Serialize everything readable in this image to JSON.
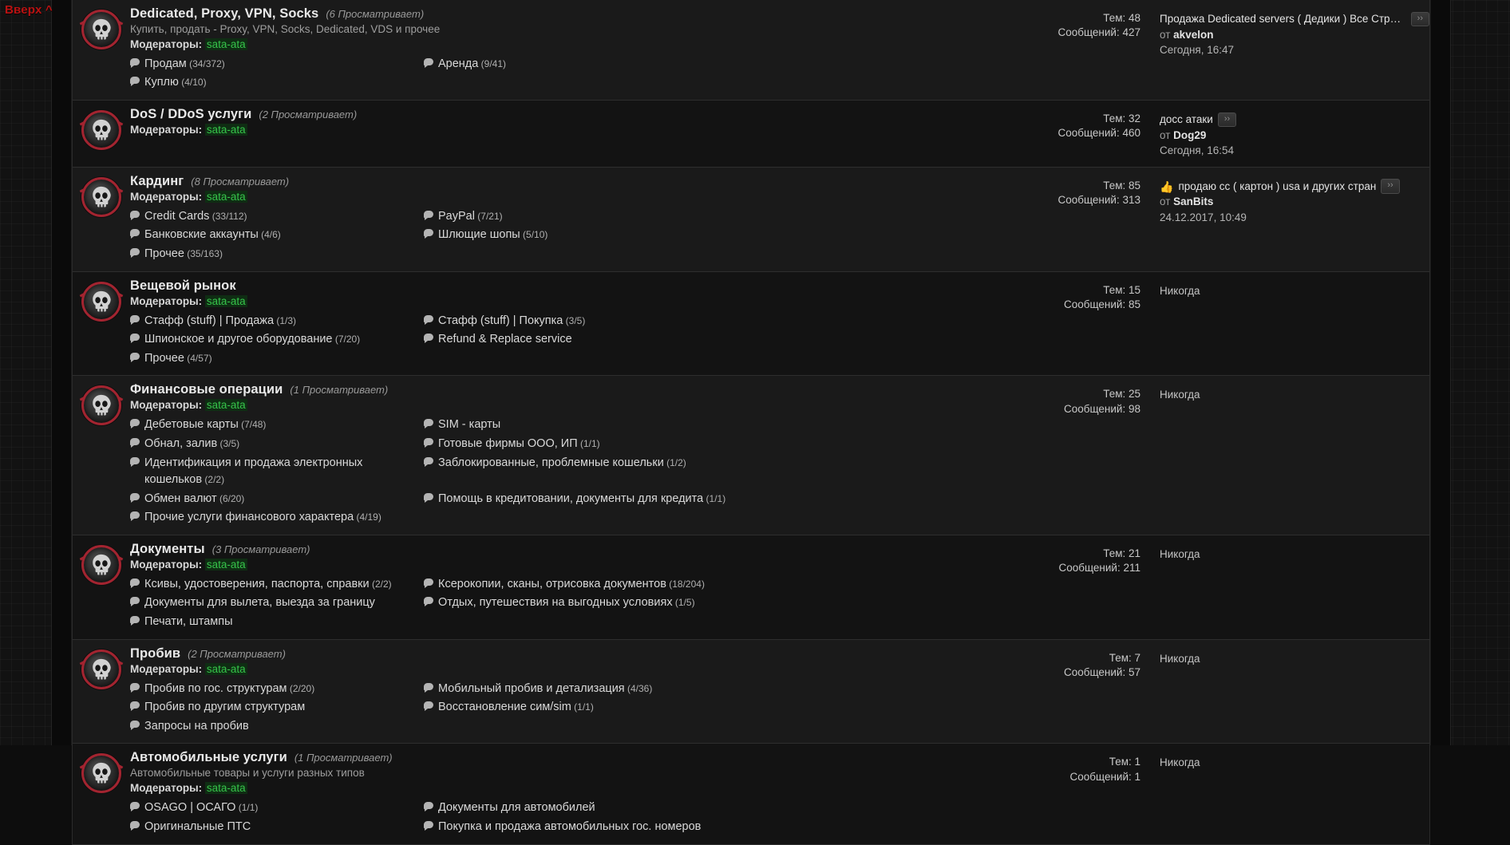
{
  "scroll_top_label": "Вверх ^",
  "labels": {
    "moderators": "Модераторы:",
    "threads_prefix": "Тем:",
    "messages_prefix": "Сообщений:",
    "by_prefix": "от",
    "never": "Никогда",
    "jump_to_last": "››"
  },
  "colors": {
    "accent_red": "#a32430",
    "moderator_green": "#36c44a",
    "scroll_top_red": "#b91212",
    "row_bg": "#1a1a1a",
    "row_bg_alt": "#131313"
  },
  "nodes": [
    {
      "title": "Dedicated, Proxy, VPN, Socks",
      "viewers": "(6 Просматривает)",
      "description": "Купить, продать - Proxy, VPN, Socks, Dedicated, VDS и прочее",
      "moderator": "sata-ata",
      "subforums": [
        {
          "label": "Продам",
          "count": "(34/372)"
        },
        {
          "label": "Аренда",
          "count": "(9/41)"
        },
        {
          "label": "Куплю",
          "count": "(4/10)"
        },
        {
          "label": "",
          "count": ""
        }
      ],
      "threads": "48",
      "messages": "427",
      "last_post": {
        "title": "Продажа Dedicated servers ( Дедики ) Все Страны...",
        "author": "akvelon",
        "date": "Сегодня, 16:47",
        "has_jump": true,
        "emoji": ""
      }
    },
    {
      "title": "DoS / DDoS услуги",
      "viewers": "(2 Просматривает)",
      "description": "",
      "moderator": "sata-ata",
      "subforums": [],
      "threads": "32",
      "messages": "460",
      "last_post": {
        "title": "досс атаки",
        "author": "Dog29",
        "date": "Сегодня, 16:54",
        "has_jump": true,
        "emoji": ""
      }
    },
    {
      "title": "Кардинг",
      "viewers": "(8 Просматривает)",
      "description": "",
      "moderator": "sata-ata",
      "subforums": [
        {
          "label": "Credit Cards",
          "count": "(33/112)"
        },
        {
          "label": "PayPal",
          "count": "(7/21)"
        },
        {
          "label": "Банковские аккаунты",
          "count": "(4/6)"
        },
        {
          "label": "Шлющие шопы",
          "count": "(5/10)"
        },
        {
          "label": "Прочее",
          "count": "(35/163)"
        },
        {
          "label": "",
          "count": ""
        }
      ],
      "threads": "85",
      "messages": "313",
      "last_post": {
        "title": "продаю cc ( картон ) usa и других стран",
        "author": "SanBits",
        "date": "24.12.2017, 10:49",
        "has_jump": true,
        "emoji": "👍"
      }
    },
    {
      "title": "Вещевой рынок",
      "viewers": "",
      "description": "",
      "moderator": "sata-ata",
      "subforums": [
        {
          "label": "Стафф (stuff) | Продажа",
          "count": "(1/3)"
        },
        {
          "label": "Стафф (stuff) | Покупка",
          "count": "(3/5)"
        },
        {
          "label": "Шпионское и другое оборудование",
          "count": "(7/20)"
        },
        {
          "label": "Refund & Replace service",
          "count": ""
        },
        {
          "label": "Прочее",
          "count": "(4/57)"
        },
        {
          "label": "",
          "count": ""
        }
      ],
      "threads": "15",
      "messages": "85",
      "last_post": {
        "title": "",
        "author": "",
        "date": "",
        "has_jump": false,
        "emoji": "",
        "never": true
      }
    },
    {
      "title": "Финансовые операции",
      "viewers": "(1 Просматривает)",
      "description": "",
      "moderator": "sata-ata",
      "subforums": [
        {
          "label": "Дебетовые карты",
          "count": "(7/48)"
        },
        {
          "label": "SIM - карты",
          "count": ""
        },
        {
          "label": "Обнал, залив",
          "count": "(3/5)"
        },
        {
          "label": "Готовые фирмы ООО, ИП",
          "count": "(1/1)"
        },
        {
          "label": "Идентификация и продажа электронных кошельков",
          "count": "(2/2)"
        },
        {
          "label": "Заблокированные, проблемные кошельки",
          "count": "(1/2)"
        },
        {
          "label": "Обмен валют",
          "count": "(6/20)"
        },
        {
          "label": "Помощь в кредитовании, документы для кредита",
          "count": "(1/1)"
        },
        {
          "label": "Прочие услуги финансового характера",
          "count": "(4/19)"
        },
        {
          "label": "",
          "count": ""
        }
      ],
      "threads": "25",
      "messages": "98",
      "last_post": {
        "title": "",
        "author": "",
        "date": "",
        "has_jump": false,
        "emoji": "",
        "never": true
      }
    },
    {
      "title": "Документы",
      "viewers": "(3 Просматривает)",
      "description": "",
      "moderator": "sata-ata",
      "subforums": [
        {
          "label": "Ксивы, удостоверения, паспорта, справки",
          "count": "(2/2)"
        },
        {
          "label": "Ксерокопии, сканы, отрисовка документов",
          "count": "(18/204)"
        },
        {
          "label": "Документы для вылета, выезда за границу",
          "count": ""
        },
        {
          "label": "Отдых, путешествия на выгодных условиях",
          "count": "(1/5)"
        },
        {
          "label": "Печати, штампы",
          "count": ""
        },
        {
          "label": "",
          "count": ""
        }
      ],
      "threads": "21",
      "messages": "211",
      "last_post": {
        "title": "",
        "author": "",
        "date": "",
        "has_jump": false,
        "emoji": "",
        "never": true
      }
    },
    {
      "title": "Пробив",
      "viewers": "(2 Просматривает)",
      "description": "",
      "moderator": "sata-ata",
      "subforums": [
        {
          "label": "Пробив по гос. структурам",
          "count": "(2/20)"
        },
        {
          "label": "Мобильный пробив и детализация",
          "count": "(4/36)"
        },
        {
          "label": "Пробив по другим структурам",
          "count": ""
        },
        {
          "label": "Восстановление сим/sim",
          "count": "(1/1)"
        },
        {
          "label": "Запросы на пробив",
          "count": ""
        },
        {
          "label": "",
          "count": ""
        }
      ],
      "threads": "7",
      "messages": "57",
      "last_post": {
        "title": "",
        "author": "",
        "date": "",
        "has_jump": false,
        "emoji": "",
        "never": true
      }
    },
    {
      "title": "Автомобильные услуги",
      "viewers": "(1 Просматривает)",
      "description": "Автомобильные товары и услуги разных типов",
      "moderator": "sata-ata",
      "subforums": [
        {
          "label": "OSAGO | ОСАГО",
          "count": "(1/1)"
        },
        {
          "label": "Документы для автомобилей",
          "count": ""
        },
        {
          "label": "Оригинальные ПТС",
          "count": ""
        },
        {
          "label": "Покупка и продажа автомобильных гос. номеров",
          "count": ""
        }
      ],
      "threads": "1",
      "messages": "1",
      "last_post": {
        "title": "",
        "author": "",
        "date": "",
        "has_jump": false,
        "emoji": "",
        "never": true
      }
    }
  ]
}
